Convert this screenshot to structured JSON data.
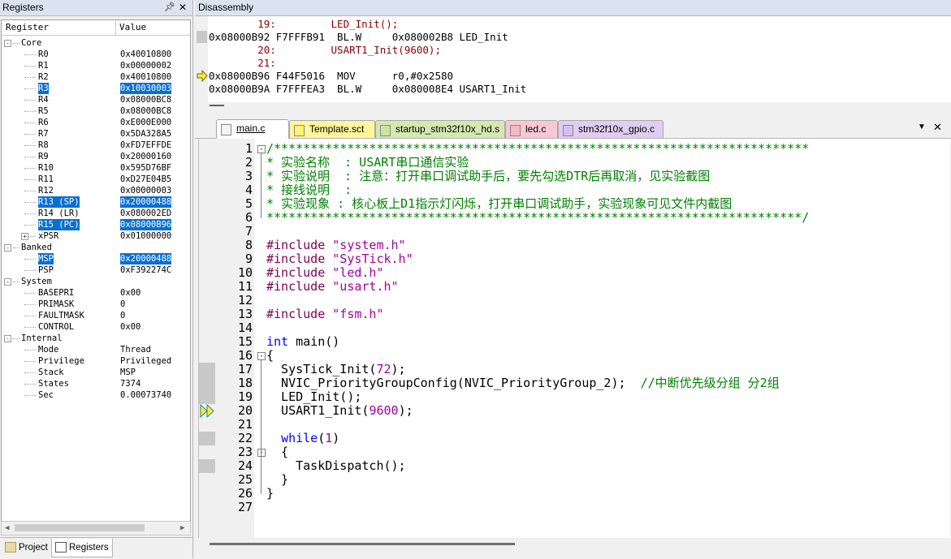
{
  "registers_panel": {
    "title": "Registers",
    "pin_icon": "pin-icon",
    "close_icon": "close-icon",
    "col_register": "Register",
    "col_value": "Value",
    "rows": [
      {
        "name": "Core",
        "value": "",
        "level": 0,
        "expander": "-",
        "group": true,
        "sel": false
      },
      {
        "name": "R0",
        "value": "0x40010800",
        "level": 2,
        "sel": false
      },
      {
        "name": "R1",
        "value": "0x00000002",
        "level": 2,
        "sel": false
      },
      {
        "name": "R2",
        "value": "0x40010800",
        "level": 2,
        "sel": false
      },
      {
        "name": "R3",
        "value": "0x10030003",
        "level": 2,
        "sel": true
      },
      {
        "name": "R4",
        "value": "0x08000BC8",
        "level": 2,
        "sel": false
      },
      {
        "name": "R5",
        "value": "0x08000BC8",
        "level": 2,
        "sel": false
      },
      {
        "name": "R6",
        "value": "0xE000E000",
        "level": 2,
        "sel": false
      },
      {
        "name": "R7",
        "value": "0x5DA328A5",
        "level": 2,
        "sel": false
      },
      {
        "name": "R8",
        "value": "0xFD7EFFDE",
        "level": 2,
        "sel": false
      },
      {
        "name": "R9",
        "value": "0x20000160",
        "level": 2,
        "sel": false
      },
      {
        "name": "R10",
        "value": "0x595D76BF",
        "level": 2,
        "sel": false
      },
      {
        "name": "R11",
        "value": "0xD27E04B5",
        "level": 2,
        "sel": false
      },
      {
        "name": "R12",
        "value": "0x00000003",
        "level": 2,
        "sel": false
      },
      {
        "name": "R13 (SP)",
        "value": "0x20000488",
        "level": 2,
        "sel": true
      },
      {
        "name": "R14 (LR)",
        "value": "0x080002ED",
        "level": 2,
        "sel": false
      },
      {
        "name": "R15 (PC)",
        "value": "0x08000B96",
        "level": 2,
        "sel": true
      },
      {
        "name": "xPSR",
        "value": "0x01000000",
        "level": 2,
        "expander": "+",
        "sel": false
      },
      {
        "name": "Banked",
        "value": "",
        "level": 0,
        "expander": "-",
        "group": true,
        "sel": false
      },
      {
        "name": "MSP",
        "value": "0x20000488",
        "level": 2,
        "sel": true
      },
      {
        "name": "PSP",
        "value": "0xF392274C",
        "level": 2,
        "sel": false
      },
      {
        "name": "System",
        "value": "",
        "level": 0,
        "expander": "-",
        "group": true,
        "sel": false
      },
      {
        "name": "BASEPRI",
        "value": "0x00",
        "level": 2,
        "sel": false
      },
      {
        "name": "PRIMASK",
        "value": "0",
        "level": 2,
        "sel": false
      },
      {
        "name": "FAULTMASK",
        "value": "0",
        "level": 2,
        "sel": false
      },
      {
        "name": "CONTROL",
        "value": "0x00",
        "level": 2,
        "sel": false
      },
      {
        "name": "Internal",
        "value": "",
        "level": 0,
        "expander": "-",
        "group": true,
        "sel": false
      },
      {
        "name": "Mode",
        "value": "Thread",
        "level": 2,
        "sel": false
      },
      {
        "name": "Privilege",
        "value": "Privileged",
        "level": 2,
        "sel": false
      },
      {
        "name": "Stack",
        "value": "MSP",
        "level": 2,
        "sel": false
      },
      {
        "name": "States",
        "value": "7374",
        "level": 2,
        "sel": false
      },
      {
        "name": "Sec",
        "value": "0.00073740",
        "level": 2,
        "sel": false
      }
    ]
  },
  "bottom_tabs": {
    "project": "Project",
    "registers": "Registers"
  },
  "disassembly": {
    "title": "Disassembly",
    "lines": [
      {
        "text": "        19:         LED_Init();",
        "type": "src",
        "mark": ""
      },
      {
        "text": "0x08000B92 F7FFFB91  BL.W     0x080002B8 LED_Init",
        "type": "asm",
        "mark": "gray"
      },
      {
        "text": "        20:         USART1_Init(9600);",
        "type": "src",
        "mark": ""
      },
      {
        "text": "        21:",
        "type": "src",
        "mark": ""
      },
      {
        "text": "0x08000B96 F44F5016  MOV      r0,#0x2580",
        "type": "asm",
        "mark": "arrow"
      },
      {
        "text": "0x08000B9A F7FFFEA3  BL.W     0x080008E4 USART1_Init",
        "type": "asm",
        "mark": ""
      }
    ]
  },
  "editor": {
    "tabs": [
      {
        "label": "main.c",
        "active": true,
        "color": "#ffffff",
        "icon_color": "#f4f4f4"
      },
      {
        "label": "Template.sct",
        "active": false,
        "color": "#fff59d",
        "icon_color": "#fff176"
      },
      {
        "label": "startup_stm32f10x_hd.s",
        "active": false,
        "color": "#d4e8b0",
        "icon_color": "#c8e6a0"
      },
      {
        "label": "led.c",
        "active": false,
        "color": "#f8c8d4",
        "icon_color": "#f7b5c5"
      },
      {
        "label": "stm32f10x_gpio.c",
        "active": false,
        "color": "#e0cdf2",
        "icon_color": "#d5bff0"
      }
    ],
    "menu_icon": "chevron-down-icon",
    "close_icon": "close-icon",
    "lines": [
      {
        "n": "1",
        "text": "/*************************************************************************",
        "cls": "cm",
        "fold": "-"
      },
      {
        "n": "2",
        "text": "* 实验名称  : USART串口通信实验",
        "cls": "cm"
      },
      {
        "n": "3",
        "text": "* 实验说明  : 注意：打开串口调试助手后，要先勾选DTR后再取消，见实验截图",
        "cls": "cm"
      },
      {
        "n": "4",
        "text": "* 接线说明  :",
        "cls": "cm"
      },
      {
        "n": "5",
        "text": "* 实验现象 : 核心板上D1指示灯闪烁，打开串口调试助手，实验现象可见文件内截图",
        "cls": "cm"
      },
      {
        "n": "6",
        "text": "*************************************************************************/",
        "cls": "cm"
      },
      {
        "n": "7",
        "text": "",
        "cls": ""
      },
      {
        "n": "8",
        "text": "#include \"system.h\"",
        "cls": "inc"
      },
      {
        "n": "9",
        "text": "#include \"SysTick.h\"",
        "cls": "inc"
      },
      {
        "n": "10",
        "text": "#include \"led.h\"",
        "cls": "inc"
      },
      {
        "n": "11",
        "text": "#include \"usart.h\"",
        "cls": "inc"
      },
      {
        "n": "12",
        "text": "",
        "cls": ""
      },
      {
        "n": "13",
        "text": "#include \"fsm.h\"",
        "cls": "inc"
      },
      {
        "n": "14",
        "text": "",
        "cls": ""
      },
      {
        "n": "15",
        "text": "int main()",
        "cls": "main"
      },
      {
        "n": "16",
        "text": "{",
        "cls": "",
        "fold": "-"
      },
      {
        "n": "17",
        "text": "  SysTick_Init(72);",
        "cls": "call",
        "mark": "gray"
      },
      {
        "n": "18",
        "text": "  NVIC_PriorityGroupConfig(NVIC_PriorityGroup_2);  //中断优先级分组 分2组",
        "cls": "nvic",
        "mark": "gray"
      },
      {
        "n": "19",
        "text": "  LED_Init();",
        "cls": "",
        "mark": "gray"
      },
      {
        "n": "20",
        "text": "  USART1_Init(9600);",
        "cls": "call",
        "mark": "arrow"
      },
      {
        "n": "21",
        "text": "",
        "cls": ""
      },
      {
        "n": "22",
        "text": "  while(1)",
        "cls": "while",
        "mark": "gray"
      },
      {
        "n": "23",
        "text": "  {",
        "cls": "",
        "fold": "-"
      },
      {
        "n": "24",
        "text": "    TaskDispatch();",
        "cls": "",
        "mark": "gray"
      },
      {
        "n": "25",
        "text": "  }",
        "cls": ""
      },
      {
        "n": "26",
        "text": "}",
        "cls": ""
      },
      {
        "n": "27",
        "text": "",
        "cls": ""
      }
    ]
  }
}
